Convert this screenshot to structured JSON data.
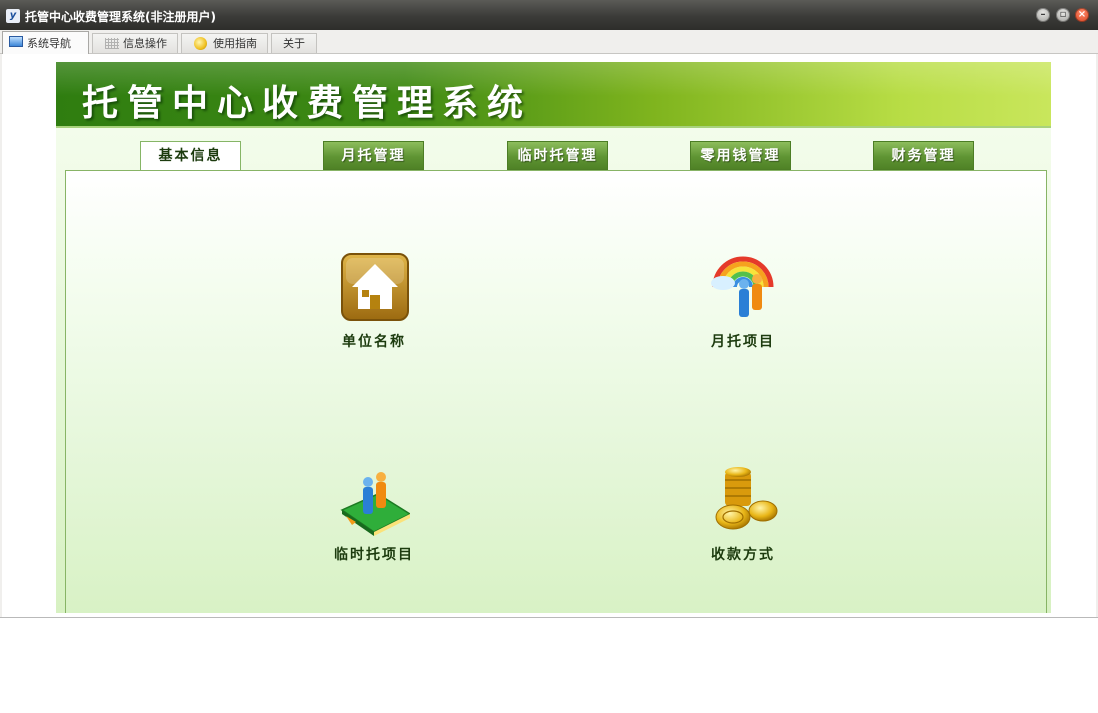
{
  "window": {
    "title": "托管中心收费管理系统(非注册用户)",
    "app_icon_letter": "y"
  },
  "toolbar_tabs": [
    {
      "label": "系统导航",
      "icon": "nav-window-icon",
      "active": true
    },
    {
      "label": "信息操作",
      "icon": "grid-icon",
      "active": false
    },
    {
      "label": "使用指南",
      "icon": "guide-globe-icon",
      "active": false
    },
    {
      "label": "关于",
      "icon": "",
      "active": false
    }
  ],
  "banner": {
    "title": "托管中心收费管理系统"
  },
  "nav_tabs": [
    {
      "label": "基本信息",
      "active": true
    },
    {
      "label": "月托管理",
      "active": false
    },
    {
      "label": "临时托管理",
      "active": false
    },
    {
      "label": "零用钱管理",
      "active": false
    },
    {
      "label": "财务管理",
      "active": false
    }
  ],
  "items": [
    {
      "label": "单位名称",
      "icon": "house-icon"
    },
    {
      "label": "月托项目",
      "icon": "rainbow-people-icon"
    },
    {
      "label": "临时托项目",
      "icon": "book-people-icon"
    },
    {
      "label": "收款方式",
      "icon": "gold-coins-icon"
    }
  ],
  "colors": {
    "banner_dark": "#2f7d10",
    "banner_light": "#c9e65c",
    "tab_green": "#5f9433",
    "label_text": "#1c3b0e"
  }
}
